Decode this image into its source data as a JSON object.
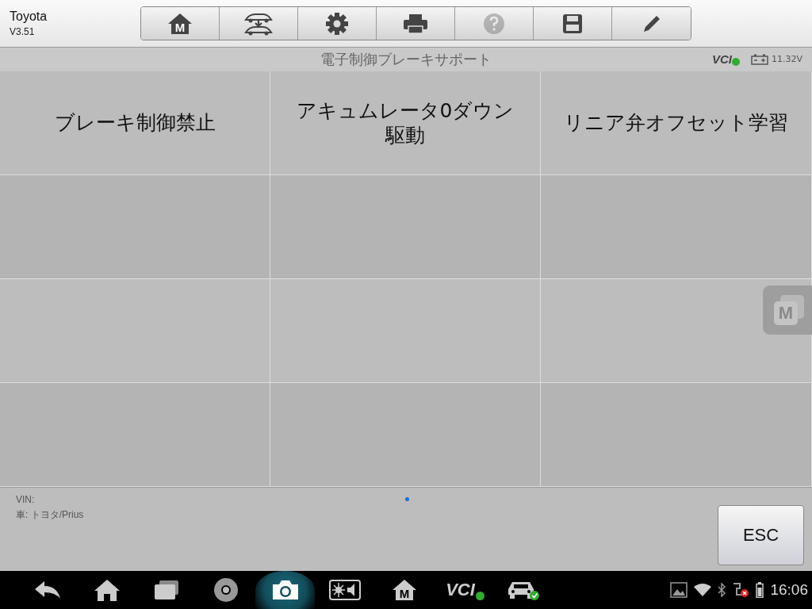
{
  "app": {
    "name": "Toyota",
    "version": "V3.51"
  },
  "toolbar": [
    {
      "kind": "home",
      "label": "M",
      "disabled": false
    },
    {
      "kind": "cars",
      "disabled": false
    },
    {
      "kind": "gear",
      "disabled": false
    },
    {
      "kind": "print",
      "disabled": false
    },
    {
      "kind": "help",
      "disabled": true
    },
    {
      "kind": "save",
      "disabled": false
    },
    {
      "kind": "pen",
      "disabled": false
    }
  ],
  "title": "電子制御ブレーキサポート",
  "status": {
    "vci": "VCI",
    "vci_connected": true,
    "voltage": "11.32V"
  },
  "functions": [
    "ブレーキ制御禁止",
    "アキュムレータ0ダウン駆動",
    "リニア弁オフセット学習"
  ],
  "floating_button": {
    "label": "M"
  },
  "footer": {
    "vin": "VIN:",
    "vehicle": "車: トヨタ/Prius",
    "esc": "ESC"
  },
  "taskbar": [
    {
      "kind": "back"
    },
    {
      "kind": "home"
    },
    {
      "kind": "recent"
    },
    {
      "kind": "browser"
    },
    {
      "kind": "camera",
      "selected": true
    },
    {
      "kind": "display"
    },
    {
      "kind": "app-m",
      "label": "M"
    },
    {
      "kind": "vci",
      "label": "VCI"
    },
    {
      "kind": "car"
    }
  ],
  "system_tray": {
    "time": "16:06"
  }
}
